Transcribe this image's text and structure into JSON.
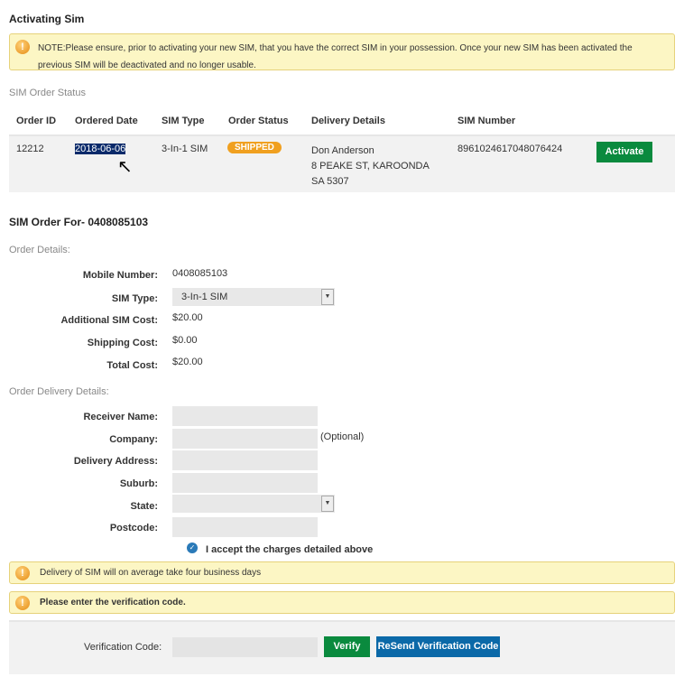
{
  "title": "Activating Sim",
  "note": "NOTE:Please ensure, prior to activating your new SIM, that you have the correct SIM in your possession. Once your new SIM has been activated the previous SIM will be deactivated and no longer usable.",
  "status_section": "SIM Order Status",
  "table": {
    "headers": [
      "Order ID",
      "Ordered Date",
      "SIM Type",
      "Order Status",
      "Delivery Details",
      "SIM Number"
    ],
    "row": {
      "order_id": "12212",
      "ordered_date": "2018-06-06",
      "sim_type": "3-In-1 SIM",
      "status": "SHIPPED",
      "delivery": [
        "Don Anderson",
        "8 PEAKE ST, KAROONDA",
        "SA 5307"
      ],
      "sim_number": "8961024617048076424",
      "action": "Activate"
    }
  },
  "order_for": "SIM Order For- 0408085103",
  "order_details": {
    "heading": "Order Details:",
    "mobile_label": "Mobile Number:",
    "mobile": "0408085103",
    "sim_type_label": "SIM Type:",
    "sim_type": "3-In-1 SIM",
    "add_cost_label": "Additional SIM Cost:",
    "add_cost": "$20.00",
    "ship_label": "Shipping Cost:",
    "ship": "$0.00",
    "total_label": "Total Cost:",
    "total": "$20.00"
  },
  "delivery_details": {
    "heading": "Order Delivery Details:",
    "receiver": "Receiver Name:",
    "company": "Company:",
    "optional": "(Optional)",
    "address": "Delivery Address:",
    "suburb": "Suburb:",
    "state": "State:",
    "postcode": "Postcode:",
    "accept": "I accept the charges detailed above"
  },
  "delivery_note": "Delivery of SIM will on average take four business days",
  "verify_note": "Please enter the verification code.",
  "verification": {
    "label": "Verification Code:",
    "verify": "Verify",
    "resend": "ReSend Verification Code"
  },
  "colors": {
    "green": "#0a8a3e",
    "blue": "#0b69a8",
    "orange": "#f0a020"
  }
}
